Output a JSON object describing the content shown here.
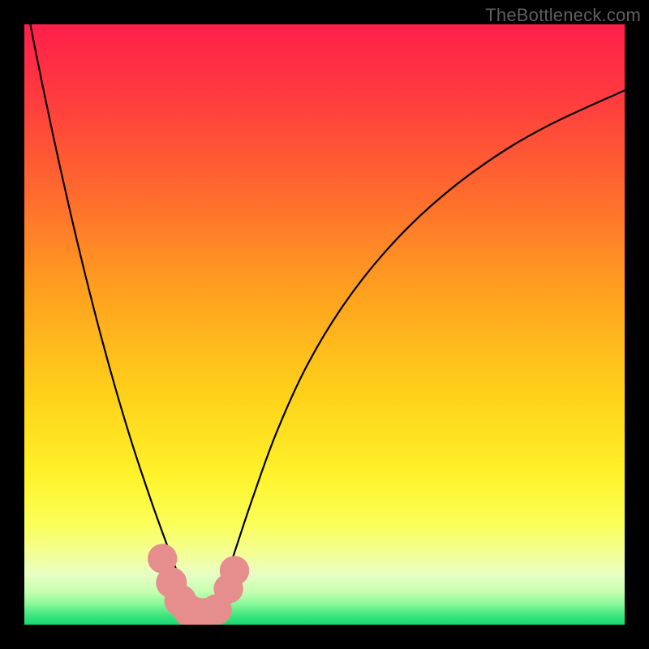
{
  "watermark": "TheBottleneck.com",
  "chart_data": {
    "type": "line",
    "title": "",
    "xlabel": "",
    "ylabel": "",
    "xlim": [
      0,
      100
    ],
    "ylim": [
      0,
      100
    ],
    "grid": false,
    "legend": false,
    "series": [
      {
        "name": "curve",
        "x": [
          0,
          3,
          6,
          9,
          12,
          15,
          18,
          21,
          23.5,
          25,
          26.5,
          28,
          29,
          30,
          31.5,
          33,
          35,
          38,
          42,
          47,
          53,
          60,
          68,
          77,
          87,
          100
        ],
        "y": [
          105,
          90,
          76,
          63,
          51,
          40,
          30,
          21,
          14,
          10,
          6,
          3,
          2,
          2,
          3,
          6,
          12,
          21,
          32,
          43,
          53,
          62,
          70,
          77,
          83,
          89
        ]
      }
    ],
    "markers": {
      "name": "highlight-cluster",
      "color": "#e68d8d",
      "points": [
        {
          "x": 23.0,
          "y": 11.0,
          "r": 3.0
        },
        {
          "x": 24.5,
          "y": 7.0,
          "r": 3.2
        },
        {
          "x": 26.0,
          "y": 4.0,
          "r": 3.4
        },
        {
          "x": 27.5,
          "y": 2.3,
          "r": 3.4
        },
        {
          "x": 29.0,
          "y": 1.8,
          "r": 3.4
        },
        {
          "x": 30.5,
          "y": 1.8,
          "r": 3.4
        },
        {
          "x": 32.0,
          "y": 2.5,
          "r": 3.2
        },
        {
          "x": 34.0,
          "y": 6.0,
          "r": 3.0
        },
        {
          "x": 35.0,
          "y": 9.0,
          "r": 3.0
        }
      ]
    },
    "gradient_stops": [
      {
        "offset": 0.0,
        "color": "#ff1f4b"
      },
      {
        "offset": 0.12,
        "color": "#ff3b3f"
      },
      {
        "offset": 0.28,
        "color": "#ff6a2e"
      },
      {
        "offset": 0.45,
        "color": "#ffa21f"
      },
      {
        "offset": 0.62,
        "color": "#ffd21a"
      },
      {
        "offset": 0.75,
        "color": "#fff22a"
      },
      {
        "offset": 0.83,
        "color": "#fbff57"
      },
      {
        "offset": 0.885,
        "color": "#f3ff99"
      },
      {
        "offset": 0.915,
        "color": "#e8ffc4"
      },
      {
        "offset": 0.945,
        "color": "#c6ffb0"
      },
      {
        "offset": 0.965,
        "color": "#8cf89b"
      },
      {
        "offset": 0.985,
        "color": "#3de57e"
      },
      {
        "offset": 1.0,
        "color": "#17d86e"
      }
    ]
  }
}
